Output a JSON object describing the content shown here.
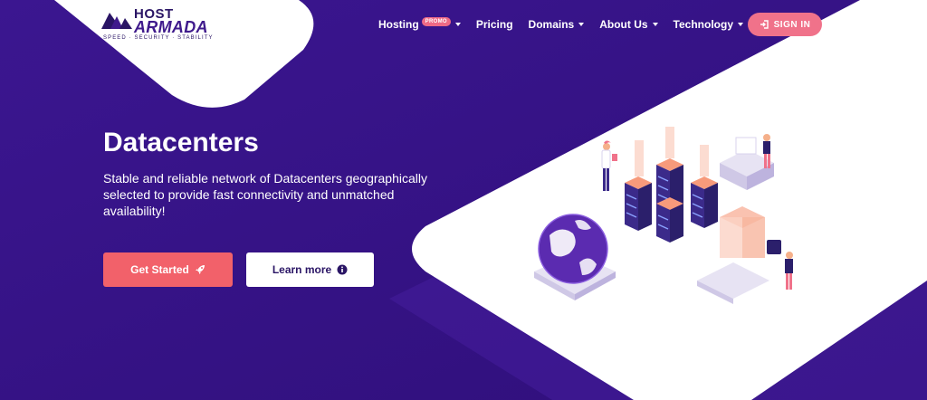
{
  "brand": {
    "host": "HOST",
    "armada": "ARMADA",
    "tagline": "SPEED · SECURITY · STABILITY"
  },
  "nav": {
    "items": [
      {
        "label": "Hosting",
        "badge": "PROMO",
        "dropdown": true
      },
      {
        "label": "Pricing",
        "dropdown": false
      },
      {
        "label": "Domains",
        "dropdown": true
      },
      {
        "label": "About Us",
        "dropdown": true
      },
      {
        "label": "Technology",
        "dropdown": true
      }
    ],
    "signin_label": "SIGN IN"
  },
  "hero": {
    "title": "Datacenters",
    "description": "Stable and reliable network of Datacenters geographically selected to provide fast connectivity and unmatched availability!",
    "primary_button": "Get Started",
    "secondary_button": "Learn more"
  },
  "icons": {
    "signin": "sign-in-icon",
    "primary": "rocket-icon",
    "secondary": "info-circle-icon"
  },
  "colors": {
    "background": "#3a1689",
    "accent_pink": "#f0728a",
    "primary_button": "#f2616a",
    "text_dark": "#2a1565"
  }
}
